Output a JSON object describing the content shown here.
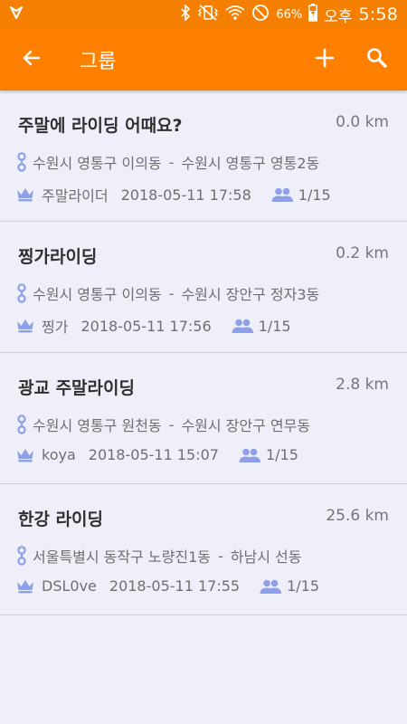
{
  "status_bar": {
    "battery_percent": "66%",
    "ampm": "오후",
    "time": "5:58",
    "icons": [
      "app-notification-icon",
      "bluetooth-icon",
      "vibrate-icon",
      "wifi-icon",
      "do-not-disturb-icon",
      "battery-charging-icon"
    ]
  },
  "app_bar": {
    "title": "그룹",
    "back_icon": "arrow-left-icon",
    "add_icon": "plus-icon",
    "search_icon": "search-icon"
  },
  "colors": {
    "app_bar": "#ff7f00",
    "status_bar": "#f57f00",
    "background": "#eeeff8",
    "icon_accent": "#8ea1e8"
  },
  "groups": [
    {
      "title": "주말에 라이딩 어때요?",
      "distance": "0.0 km",
      "from": "수원시 영통구 이의동",
      "separator": "-",
      "to": "수원시 영통구 영통2동",
      "leader": "주말라이더",
      "datetime": "2018-05-11 17:58",
      "members": "1/15"
    },
    {
      "title": "찡가라이딩",
      "distance": "0.2 km",
      "from": "수원시 영통구 이의동",
      "separator": "-",
      "to": "수원시 장안구 정자3동",
      "leader": "찡가",
      "datetime": "2018-05-11 17:56",
      "members": "1/15"
    },
    {
      "title": "광교 주말라이딩",
      "distance": "2.8 km",
      "from": "수원시 영통구 원천동",
      "separator": "-",
      "to": "수원시 장안구 연무동",
      "leader": "koya",
      "datetime": "2018-05-11 15:07",
      "members": "1/15"
    },
    {
      "title": "한강 라이딩",
      "distance": "25.6 km",
      "from": "서울특별시 동작구 노량진1동",
      "separator": "-",
      "to": "하남시 선동",
      "leader": "DSL0ve",
      "datetime": "2018-05-11 17:55",
      "members": "1/15"
    }
  ]
}
